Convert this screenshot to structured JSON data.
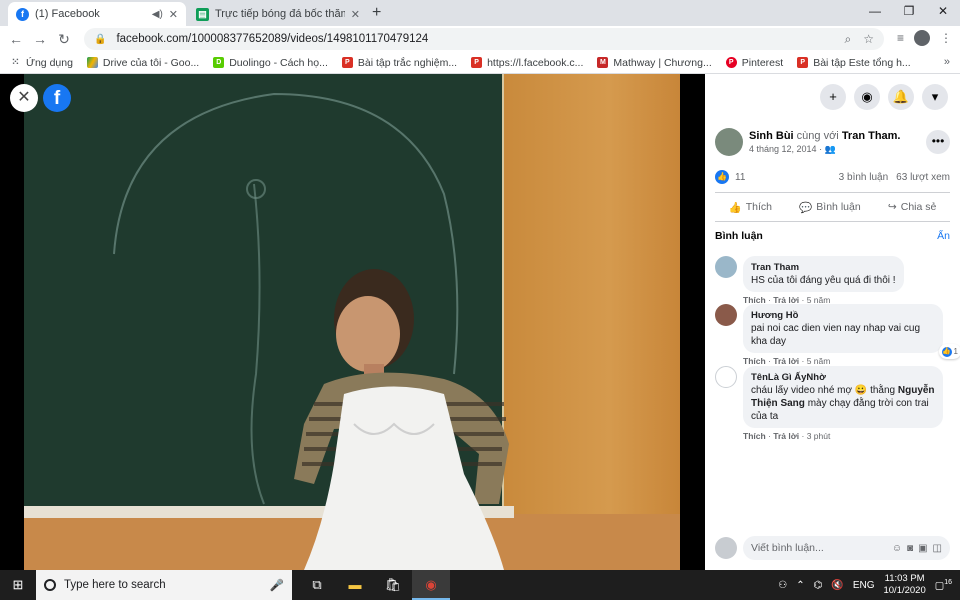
{
  "browser": {
    "tabs": [
      {
        "title": "(1) Facebook",
        "favicon": "facebook-icon",
        "active": true,
        "audio": true
      },
      {
        "title": "Trực tiếp bóng đá bốc thăm Cha",
        "favicon": "sheets-icon",
        "active": false
      }
    ],
    "url": "facebook.com/100008377652089/videos/1498101170479124",
    "bookmarks": [
      {
        "label": "Ứng dụng",
        "icon": "apps-grid-icon"
      },
      {
        "label": "Drive của tôi - Goo...",
        "icon": "drive-icon"
      },
      {
        "label": "Duolingo - Cách họ...",
        "icon": "duolingo-icon"
      },
      {
        "label": "Bài tập trắc nghiệm...",
        "icon": "pdf-icon"
      },
      {
        "label": "https://l.facebook.c...",
        "icon": "pdf-icon"
      },
      {
        "label": "Mathway | Chương...",
        "icon": "mathway-icon"
      },
      {
        "label": "Pinterest",
        "icon": "pinterest-icon"
      },
      {
        "label": "Bài tập Este tổng h...",
        "icon": "pdf-icon"
      }
    ]
  },
  "post": {
    "author": "Sinh Bùi",
    "with_text": "cùng với",
    "tagged": "Tran Tham.",
    "date": "4 tháng 12, 2014",
    "likes": "11",
    "comments_count": "3 bình luận",
    "views": "63 lượt xem",
    "actions": {
      "like": "Thích",
      "comment": "Bình luận",
      "share": "Chia sẻ"
    },
    "comments_heading": "Bình luận",
    "hide_label": "Ẩn",
    "comments": [
      {
        "name": "Tran Tham",
        "text": "HS của tôi đáng yêu quá đi thôi !",
        "like": "Thích",
        "reply": "Trả lời",
        "time": "5 năm",
        "reactions": ""
      },
      {
        "name": "Hương Hồ",
        "text": "pai noi cac dien vien nay nhap vai cug kha day",
        "like": "Thích",
        "reply": "Trả lời",
        "time": "5 năm",
        "reactions": "1"
      },
      {
        "name": "TênLà Gì ẤyNhờ",
        "text_before": "cháu lấy video nhé mợ 😀 thằng",
        "text_mention": "Nguyễn Thiện Sang",
        "text_after": "mày chạy đằng trời con trai của ta",
        "like": "Thích",
        "reply": "Trả lời",
        "time": "3 phút",
        "reactions": ""
      }
    ],
    "write_placeholder": "Viết bình luận..."
  },
  "taskbar": {
    "search_placeholder": "Type here to search",
    "time": "11:03 PM",
    "date": "10/1/2020",
    "lang": "ENG",
    "notif_count": "16"
  },
  "colors": {
    "facebook_blue": "#1877f2",
    "taskbar": "#1e1e1e"
  }
}
